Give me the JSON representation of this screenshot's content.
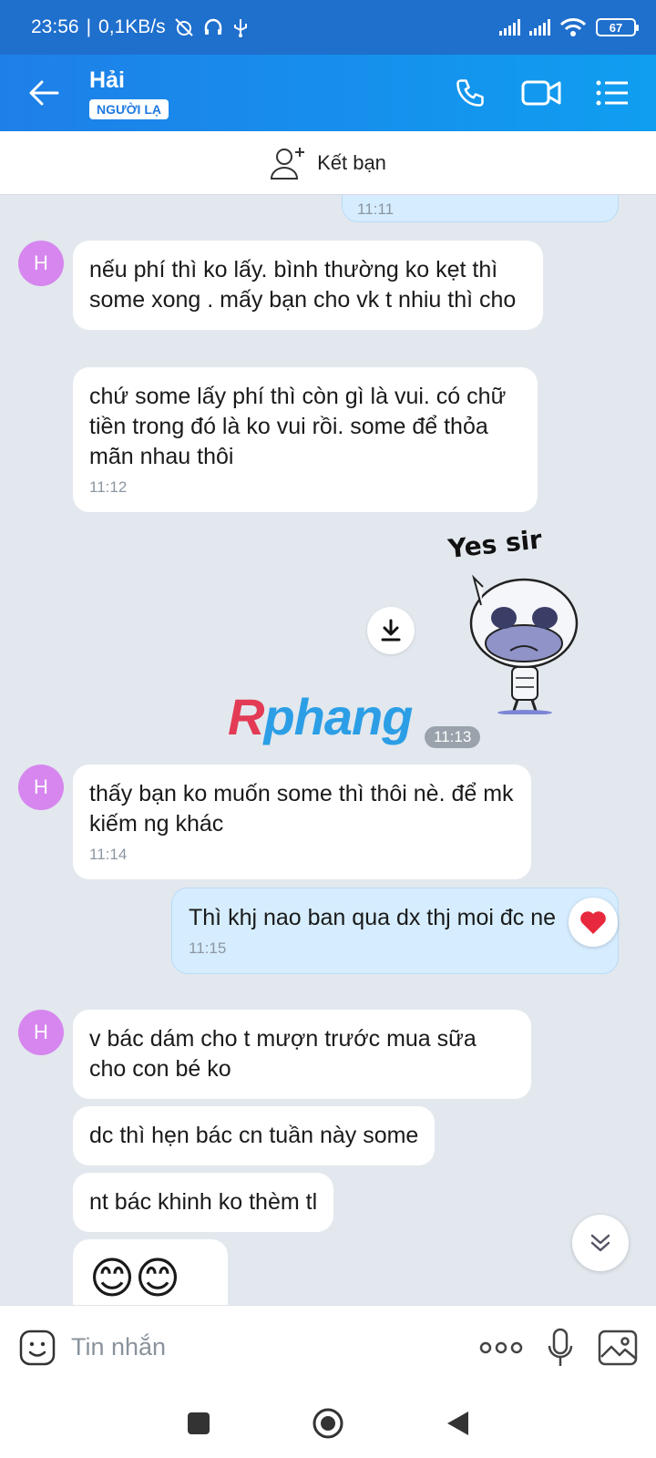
{
  "status_bar": {
    "time": "23:56",
    "speed": "0,1KB/s",
    "battery": "67"
  },
  "header": {
    "name": "Hải",
    "badge": "NGƯỜI LẠ"
  },
  "add_friend": {
    "label": "Kết bạn"
  },
  "messages": {
    "m0_time": "11:11",
    "m1_text": "nếu phí thì ko lấy. bình thường ko kẹt thì some xong . mấy bạn cho vk t nhiu thì cho",
    "m2_text": "chứ some lấy phí thì còn gì là vui. có chữ tiền trong đó là ko vui rồi. some để thỏa mãn nhau thôi",
    "m2_time": "11:12",
    "sticker_text": "Yes sir",
    "sticker_time": "11:13",
    "m3_text": "thấy bạn ko muốn some thì thôi nè. để mk kiếm ng khác",
    "m3_time": "11:14",
    "m4_text": "Thì khj nao ban qua dx thj moi đc ne",
    "m4_time": "11:15",
    "m5_text": "v bác dám cho t  mượn trước mua sữa cho con bé ko",
    "m6_text": "dc thì hẹn bác cn tuần này some",
    "m7_text": "nt bác khinh ko thèm tl",
    "m8_text": "😊😊"
  },
  "avatar_initial": "H",
  "watermark": {
    "part1": "R",
    "part2": "phang"
  },
  "input": {
    "placeholder": "Tin nhắn"
  },
  "icons": {
    "back": "arrow-left-icon",
    "call": "phone-icon",
    "video": "video-camera-icon",
    "menu": "list-menu-icon",
    "add_friend": "add-user-icon",
    "download": "download-icon",
    "reaction": "heart-icon",
    "scroll": "chevron-double-down-icon",
    "emoji": "emoji-icon",
    "more": "more-dots-icon",
    "mic": "microphone-icon",
    "image": "image-icon"
  },
  "colors": {
    "header": "#1e7fe8",
    "status_bar": "#1f6fcd",
    "my_bubble": "#d6edff",
    "avatar": "#d686ee",
    "chat_bg": "#e2e8ee"
  }
}
